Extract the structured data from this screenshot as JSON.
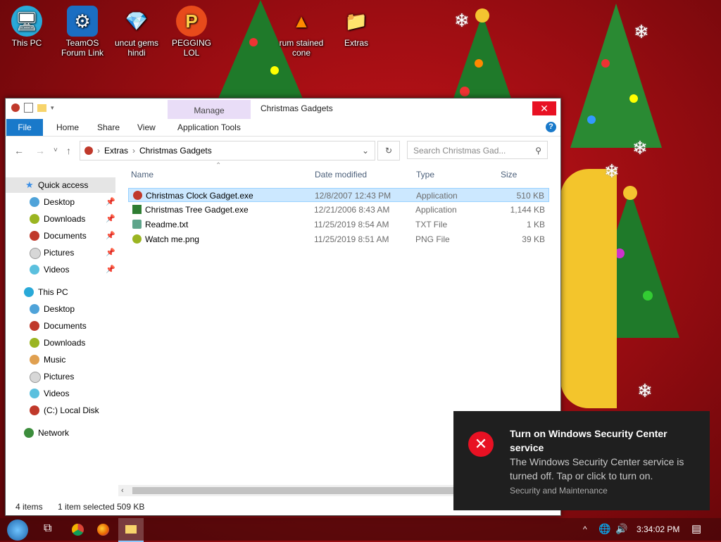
{
  "desktop": {
    "icons": [
      {
        "label": "This PC"
      },
      {
        "label": "TeamOS Forum Link"
      },
      {
        "label": "uncut gems hindi"
      },
      {
        "label": "PEGGING LOL"
      },
      {
        "label": "rum stained cone"
      },
      {
        "label": "Extras"
      }
    ]
  },
  "window": {
    "title": "Christmas Gadgets",
    "manage_tab": "Manage",
    "close_glyph": "✕",
    "ribbon_tabs": [
      "File",
      "Home",
      "Share",
      "View",
      "Application Tools"
    ],
    "help_glyph": "?",
    "breadcrumb": [
      "Extras",
      "Christmas Gadgets"
    ],
    "search_placeholder": "Search Christmas Gad...",
    "columns": {
      "name": "Name",
      "date": "Date modified",
      "type": "Type",
      "size": "Size"
    },
    "files": [
      {
        "name": "Christmas Clock Gadget.exe",
        "date": "12/8/2007 12:43 PM",
        "type": "Application",
        "size": "510 KB",
        "icon_color": "#c0392b"
      },
      {
        "name": "Christmas Tree Gadget.exe",
        "date": "12/21/2006 8:43 AM",
        "type": "Application",
        "size": "1,144 KB",
        "icon_color": "#2e7d32"
      },
      {
        "name": "Readme.txt",
        "date": "11/25/2019 8:54 AM",
        "type": "TXT File",
        "size": "1 KB",
        "icon_color": "#5fa58b"
      },
      {
        "name": "Watch me.png",
        "date": "11/25/2019 8:51 AM",
        "type": "PNG File",
        "size": "39 KB",
        "icon_color": "#9bb521"
      }
    ],
    "nav": {
      "quick_access": "Quick access",
      "quick_items": [
        "Desktop",
        "Downloads",
        "Documents",
        "Pictures",
        "Videos"
      ],
      "this_pc": "This PC",
      "pc_items": [
        "Desktop",
        "Documents",
        "Downloads",
        "Music",
        "Pictures",
        "Videos",
        "(C:) Local Disk"
      ],
      "network": "Network"
    },
    "status": {
      "count": "4 items",
      "selection": "1 item selected",
      "size": "509 KB"
    }
  },
  "toast": {
    "title": "Turn on Windows Security Center service",
    "body": "The Windows Security Center service is turned off. Tap or click to turn on.",
    "source": "Security and Maintenance"
  },
  "taskbar": {
    "clock": "3:34:02 PM"
  }
}
